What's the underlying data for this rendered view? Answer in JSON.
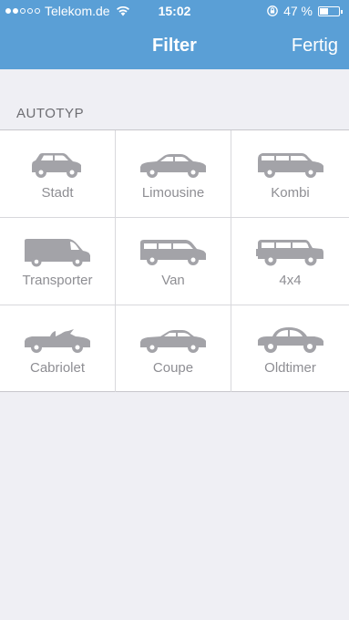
{
  "status_bar": {
    "carrier": "Telekom.de",
    "time": "15:02",
    "battery": "47 %",
    "battery_level": 0.47,
    "signal_bars_filled": 2,
    "signal_bars_total": 5
  },
  "nav": {
    "title": "Filter",
    "done_label": "Fertig"
  },
  "section": {
    "header": "AUTOTYP"
  },
  "car_types": [
    {
      "label": "Stadt",
      "icon": "city-car-icon"
    },
    {
      "label": "Limousine",
      "icon": "sedan-icon"
    },
    {
      "label": "Kombi",
      "icon": "station-wagon-icon"
    },
    {
      "label": "Transporter",
      "icon": "transporter-icon"
    },
    {
      "label": "Van",
      "icon": "van-icon"
    },
    {
      "label": "4x4",
      "icon": "suv-4x4-icon"
    },
    {
      "label": "Cabriolet",
      "icon": "cabriolet-icon"
    },
    {
      "label": "Coupe",
      "icon": "coupe-icon"
    },
    {
      "label": "Oldtimer",
      "icon": "oldtimer-icon"
    }
  ],
  "colors": {
    "nav_background": "#5a9fd6",
    "page_background": "#efeff4",
    "icon_gray": "#a3a3a8"
  }
}
